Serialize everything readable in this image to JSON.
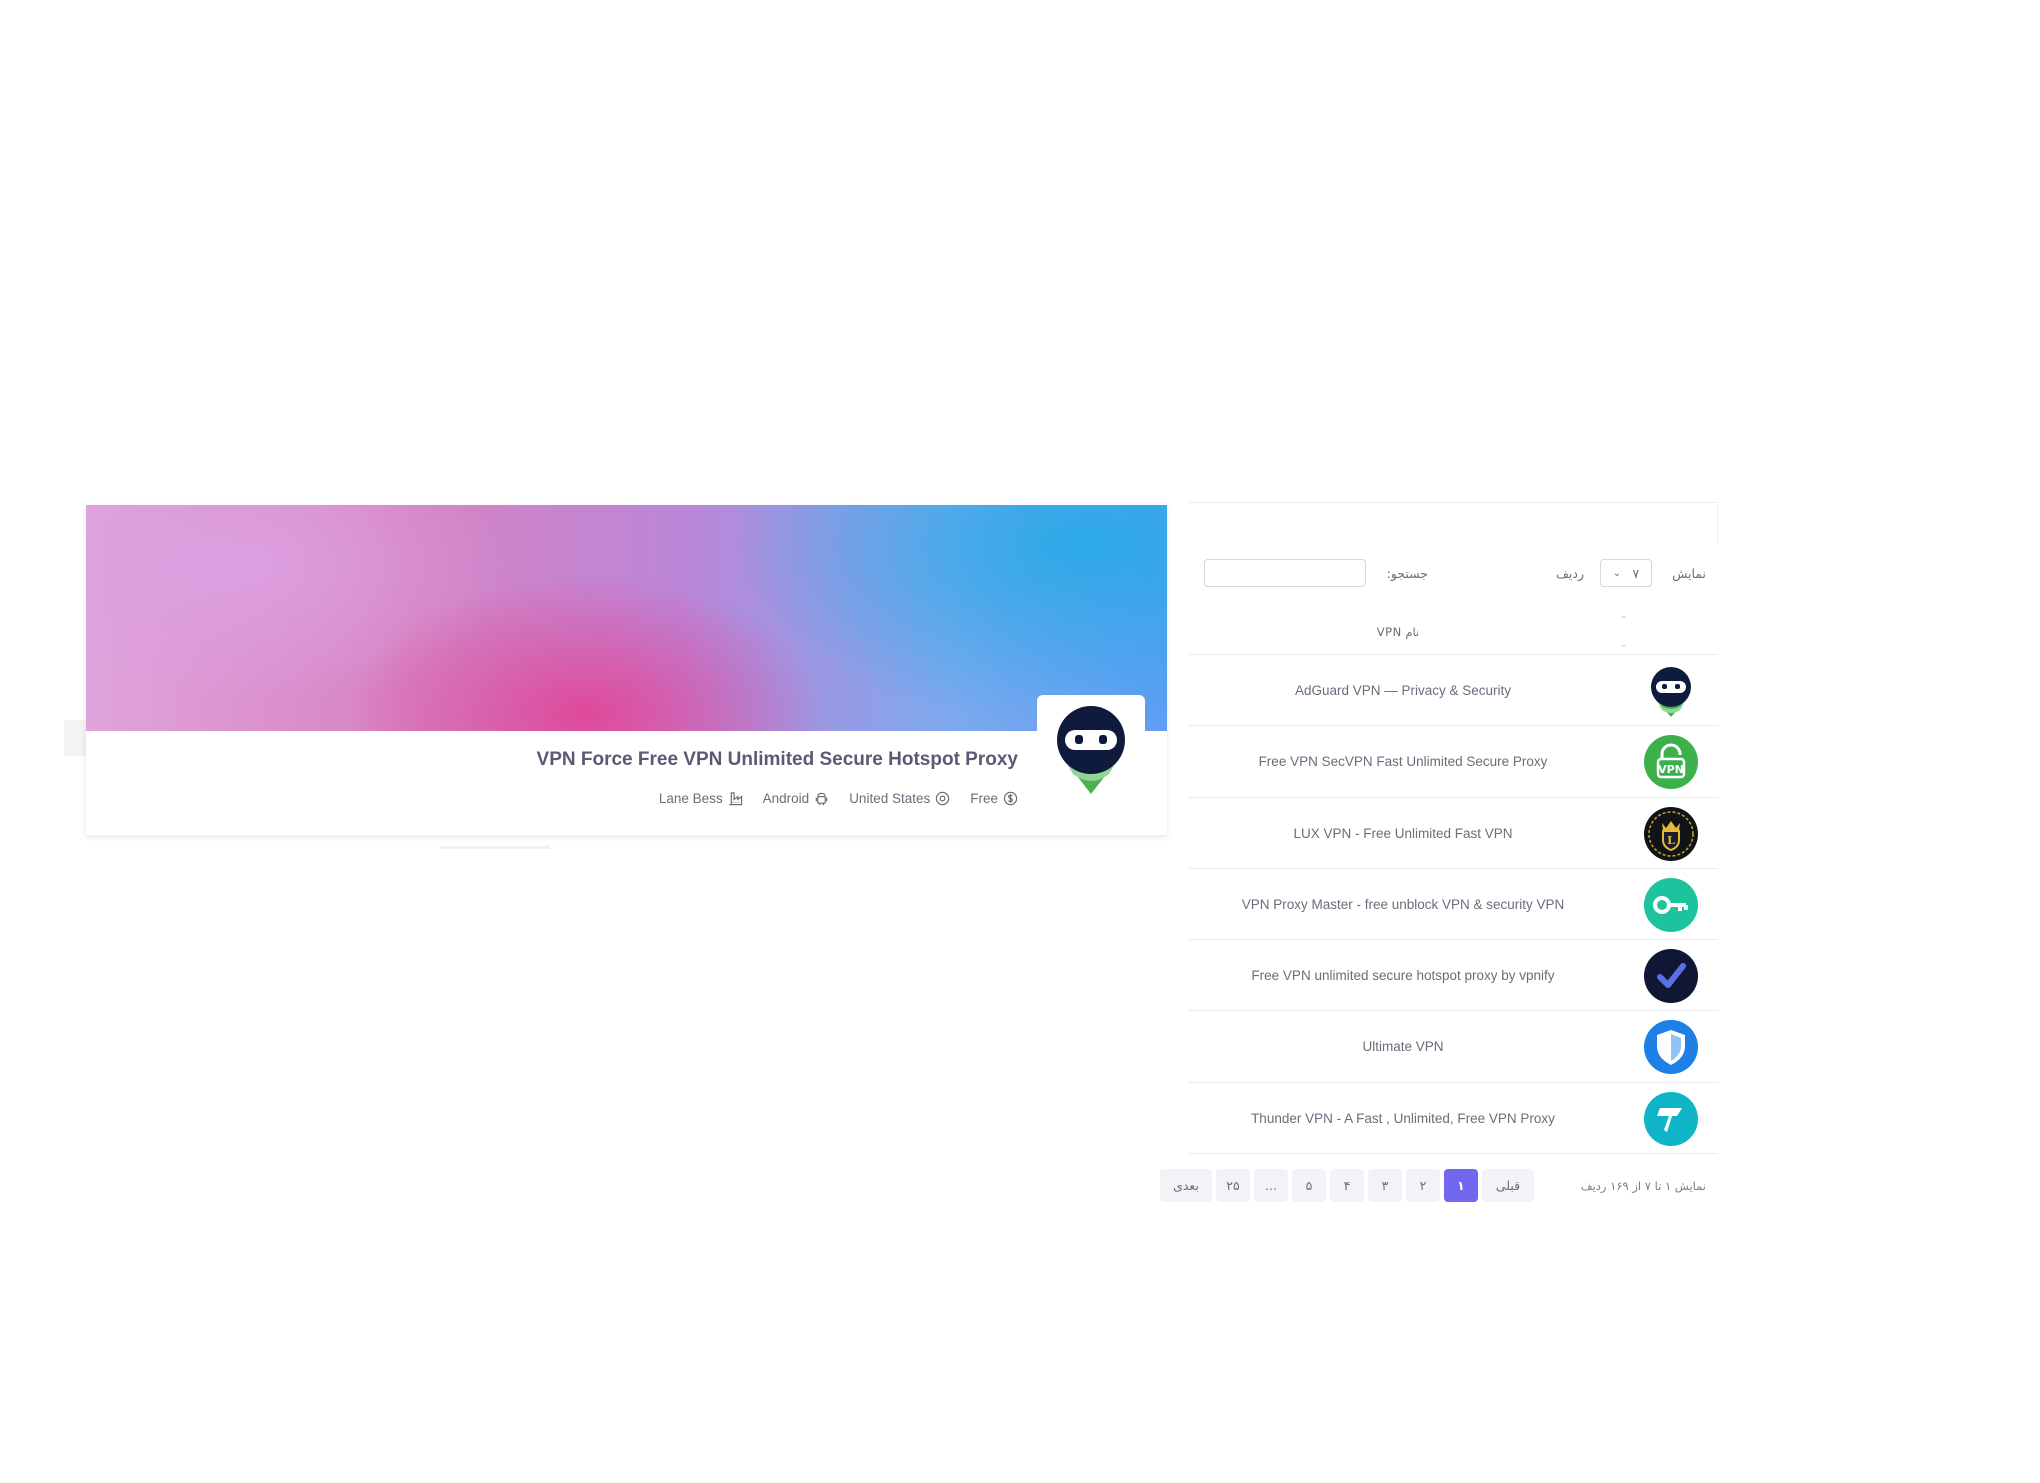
{
  "profile": {
    "title": "VPN Force Free VPN Unlimited Secure Hotspot Proxy",
    "meta": {
      "price": "Free",
      "country": "United States",
      "platform": "Android",
      "developer": "Lane Bess"
    },
    "icons": {
      "price": "dollar-icon",
      "country": "location-pin-icon",
      "platform": "android-icon",
      "developer": "factory-icon"
    }
  },
  "table": {
    "show_label": "نمایش",
    "rows_value": "۷",
    "rows_label": "ردیف",
    "search_label": "جستجو:",
    "search_placeholder": "",
    "column_header": "نام VPN",
    "rows": [
      {
        "name": "AdGuard VPN — Privacy & Security",
        "icon": "ninja-mask-icon"
      },
      {
        "name": "Free VPN SecVPN Fast Unlimited Secure Proxy",
        "icon": "vpn-lock-icon"
      },
      {
        "name": "LUX VPN - Free Unlimited Fast VPN",
        "icon": "crown-shield-icon"
      },
      {
        "name": "VPN Proxy Master - free unblock VPN & security VPN",
        "icon": "key-icon"
      },
      {
        "name": "Free VPN unlimited secure hotspot proxy by vpnify",
        "icon": "checkmark-icon"
      },
      {
        "name": "Ultimate VPN",
        "icon": "shield-icon"
      },
      {
        "name": "Thunder VPN - A Fast , Unlimited, Free VPN Proxy",
        "icon": "lightning-icon"
      }
    ],
    "footer_info": "نمایش ۱ تا ۷ از ۱۶۹ ردیف",
    "pagination": {
      "prev": "قبلی",
      "pages": [
        "۱",
        "۲",
        "۳",
        "۴",
        "۵",
        "...",
        "۲۵"
      ],
      "next": "بعدی",
      "active": "۱"
    }
  },
  "colors": {
    "accent": "#7367f0",
    "text": "#6e6b7b",
    "heading": "#5e5873"
  }
}
